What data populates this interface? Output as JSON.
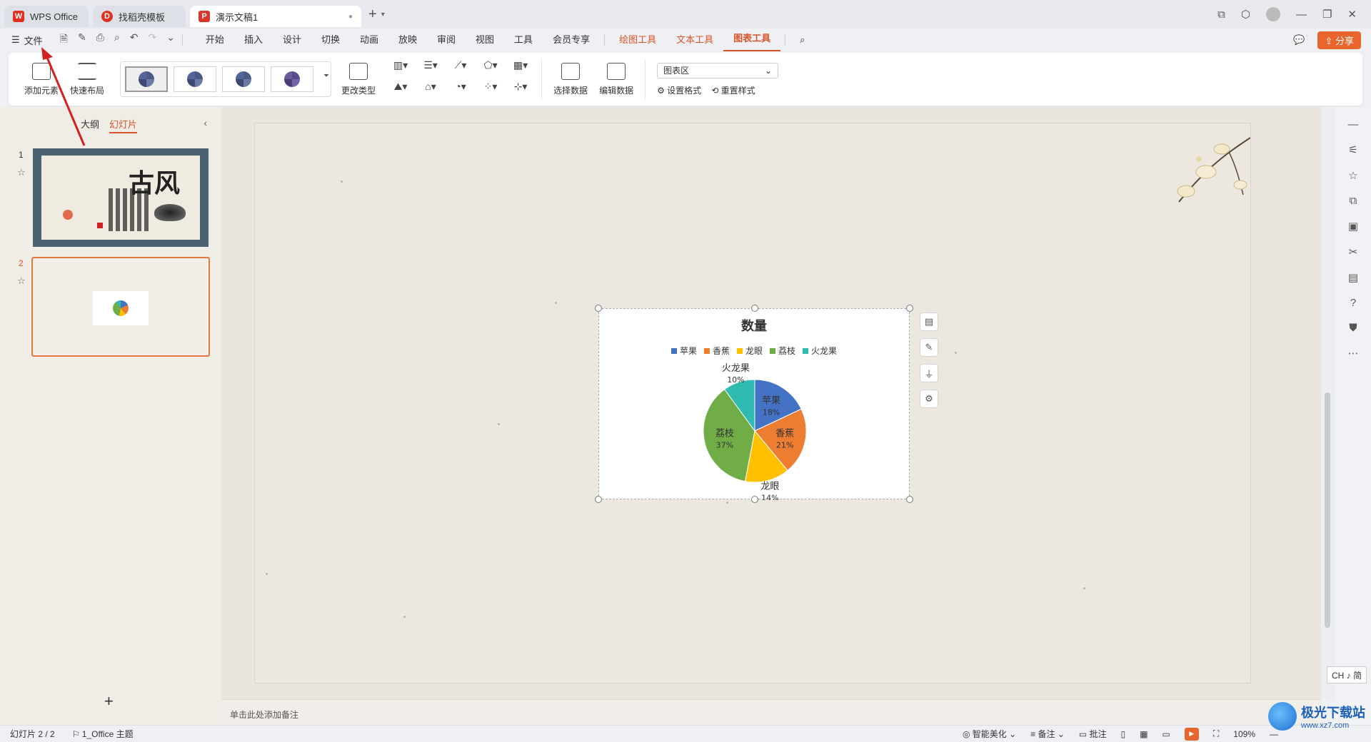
{
  "tabs": {
    "wps": "WPS Office",
    "template": "找稻壳模板",
    "doc": "演示文稿1"
  },
  "menubar": {
    "file": "文件",
    "items": [
      "开始",
      "插入",
      "设计",
      "切换",
      "动画",
      "放映",
      "审阅",
      "视图",
      "工具",
      "会员专享"
    ],
    "context": [
      "绘图工具",
      "文本工具"
    ],
    "selected": "图表工具",
    "share": "分享"
  },
  "ribbon": {
    "add_element": "添加元素",
    "quick_layout": "快速布局",
    "change_type": "更改类型",
    "select_data": "选择数据",
    "edit_data": "编辑数据",
    "area_select": "图表区",
    "format": "设置格式",
    "reset_style": "重置样式"
  },
  "leftpanel": {
    "outline": "大纲",
    "slides": "幻灯片",
    "slide1_num": "1",
    "slide2_num": "2",
    "slide1_big": "古风"
  },
  "notes_placeholder": "单击此处添加备注",
  "statusbar": {
    "slide_count": "幻灯片 2 / 2",
    "theme": "1_Office 主题",
    "beautify": "智能美化",
    "notes": "备注",
    "comments": "批注",
    "zoom": "109%"
  },
  "ime": "CH ♪ 简",
  "watermark": {
    "name": "极光下载站",
    "url": "www.xz7.com"
  },
  "chart_data": {
    "type": "pie",
    "title": "数量",
    "categories": [
      "苹果",
      "香蕉",
      "龙眼",
      "荔枝",
      "火龙果"
    ],
    "values": [
      18,
      21,
      14,
      37,
      10
    ],
    "labels": [
      "18%",
      "21%",
      "14%",
      "37%",
      "10%"
    ],
    "colors": [
      "#4472c4",
      "#ed7d31",
      "#ffc000",
      "#70ad47",
      "#2fbbb0"
    ],
    "legend": "top"
  }
}
